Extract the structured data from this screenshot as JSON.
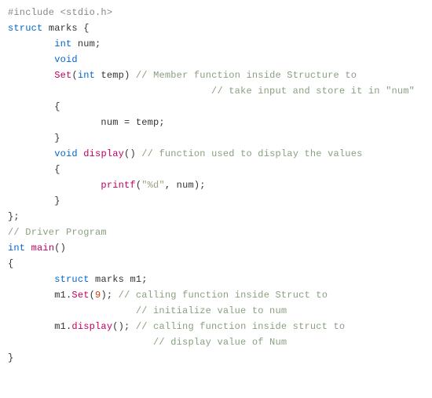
{
  "code": {
    "lines": [
      {
        "i": 0,
        "tokens": [
          {
            "cls": "pp",
            "t": "#include"
          },
          {
            "cls": "",
            "t": " "
          },
          {
            "cls": "pp",
            "t": "<stdio.h>"
          }
        ]
      },
      {
        "i": 1,
        "tokens": [
          {
            "cls": "kw",
            "t": "struct"
          },
          {
            "cls": "",
            "t": " marks {"
          }
        ]
      },
      {
        "i": 2,
        "tokens": [
          {
            "cls": "",
            "t": "        "
          },
          {
            "cls": "kw",
            "t": "int"
          },
          {
            "cls": "",
            "t": " num;"
          }
        ]
      },
      {
        "i": 3,
        "tokens": [
          {
            "cls": "",
            "t": "        "
          },
          {
            "cls": "kw",
            "t": "void"
          }
        ]
      },
      {
        "i": 4,
        "tokens": [
          {
            "cls": "",
            "t": "        "
          },
          {
            "cls": "fn",
            "t": "Set"
          },
          {
            "cls": "",
            "t": "("
          },
          {
            "cls": "kw",
            "t": "int"
          },
          {
            "cls": "",
            "t": " temp) "
          },
          {
            "cls": "cmt",
            "t": "// Member function inside Structure to"
          }
        ]
      },
      {
        "i": 5,
        "tokens": [
          {
            "cls": "",
            "t": "                                   "
          },
          {
            "cls": "cmt",
            "t": "// take input and store it in \"num\""
          }
        ]
      },
      {
        "i": 6,
        "tokens": [
          {
            "cls": "",
            "t": "        {"
          }
        ]
      },
      {
        "i": 7,
        "tokens": [
          {
            "cls": "",
            "t": "                num = temp;"
          }
        ]
      },
      {
        "i": 8,
        "tokens": [
          {
            "cls": "",
            "t": "        }"
          }
        ]
      },
      {
        "i": 9,
        "tokens": [
          {
            "cls": "",
            "t": "        "
          },
          {
            "cls": "kw",
            "t": "void"
          },
          {
            "cls": "",
            "t": " "
          },
          {
            "cls": "fn",
            "t": "display"
          },
          {
            "cls": "",
            "t": "() "
          },
          {
            "cls": "cmt",
            "t": "// function used to display the values"
          }
        ]
      },
      {
        "i": 10,
        "tokens": [
          {
            "cls": "",
            "t": "        {"
          }
        ]
      },
      {
        "i": 11,
        "tokens": [
          {
            "cls": "",
            "t": "                "
          },
          {
            "cls": "fn",
            "t": "printf"
          },
          {
            "cls": "",
            "t": "("
          },
          {
            "cls": "str",
            "t": "\"%d\""
          },
          {
            "cls": "",
            "t": ", num);"
          }
        ]
      },
      {
        "i": 12,
        "tokens": [
          {
            "cls": "",
            "t": "        }"
          }
        ]
      },
      {
        "i": 13,
        "tokens": [
          {
            "cls": "",
            "t": "};"
          }
        ]
      },
      {
        "i": 14,
        "tokens": [
          {
            "cls": "cmt",
            "t": "// Driver Program"
          }
        ]
      },
      {
        "i": 15,
        "tokens": [
          {
            "cls": "kw",
            "t": "int"
          },
          {
            "cls": "",
            "t": " "
          },
          {
            "cls": "fn",
            "t": "main"
          },
          {
            "cls": "",
            "t": "()"
          }
        ]
      },
      {
        "i": 16,
        "tokens": [
          {
            "cls": "",
            "t": "{"
          }
        ]
      },
      {
        "i": 17,
        "tokens": [
          {
            "cls": "",
            "t": "        "
          },
          {
            "cls": "kw",
            "t": "struct"
          },
          {
            "cls": "",
            "t": " marks m1;"
          }
        ]
      },
      {
        "i": 18,
        "tokens": [
          {
            "cls": "",
            "t": "        m1."
          },
          {
            "cls": "fn",
            "t": "Set"
          },
          {
            "cls": "",
            "t": "("
          },
          {
            "cls": "num",
            "t": "9"
          },
          {
            "cls": "",
            "t": "); "
          },
          {
            "cls": "cmt",
            "t": "// calling function inside Struct to"
          }
        ]
      },
      {
        "i": 19,
        "tokens": [
          {
            "cls": "",
            "t": "                      "
          },
          {
            "cls": "cmt",
            "t": "// initialize value to num"
          }
        ]
      },
      {
        "i": 20,
        "tokens": [
          {
            "cls": "",
            "t": "        m1."
          },
          {
            "cls": "fn",
            "t": "display"
          },
          {
            "cls": "",
            "t": "(); "
          },
          {
            "cls": "cmt",
            "t": "// calling function inside struct to"
          }
        ]
      },
      {
        "i": 21,
        "tokens": [
          {
            "cls": "",
            "t": "                         "
          },
          {
            "cls": "cmt",
            "t": "// display value of Num"
          }
        ]
      },
      {
        "i": 22,
        "tokens": [
          {
            "cls": "",
            "t": "}"
          }
        ]
      }
    ]
  },
  "language": "C/C++",
  "colors": {
    "preprocessor": "#888888",
    "keyword": "#0066cc",
    "function": "#c00060",
    "comment": "#8aa080",
    "number": "#d04000",
    "string": "#a0a080",
    "default": "#333333",
    "background": "#ffffff"
  }
}
